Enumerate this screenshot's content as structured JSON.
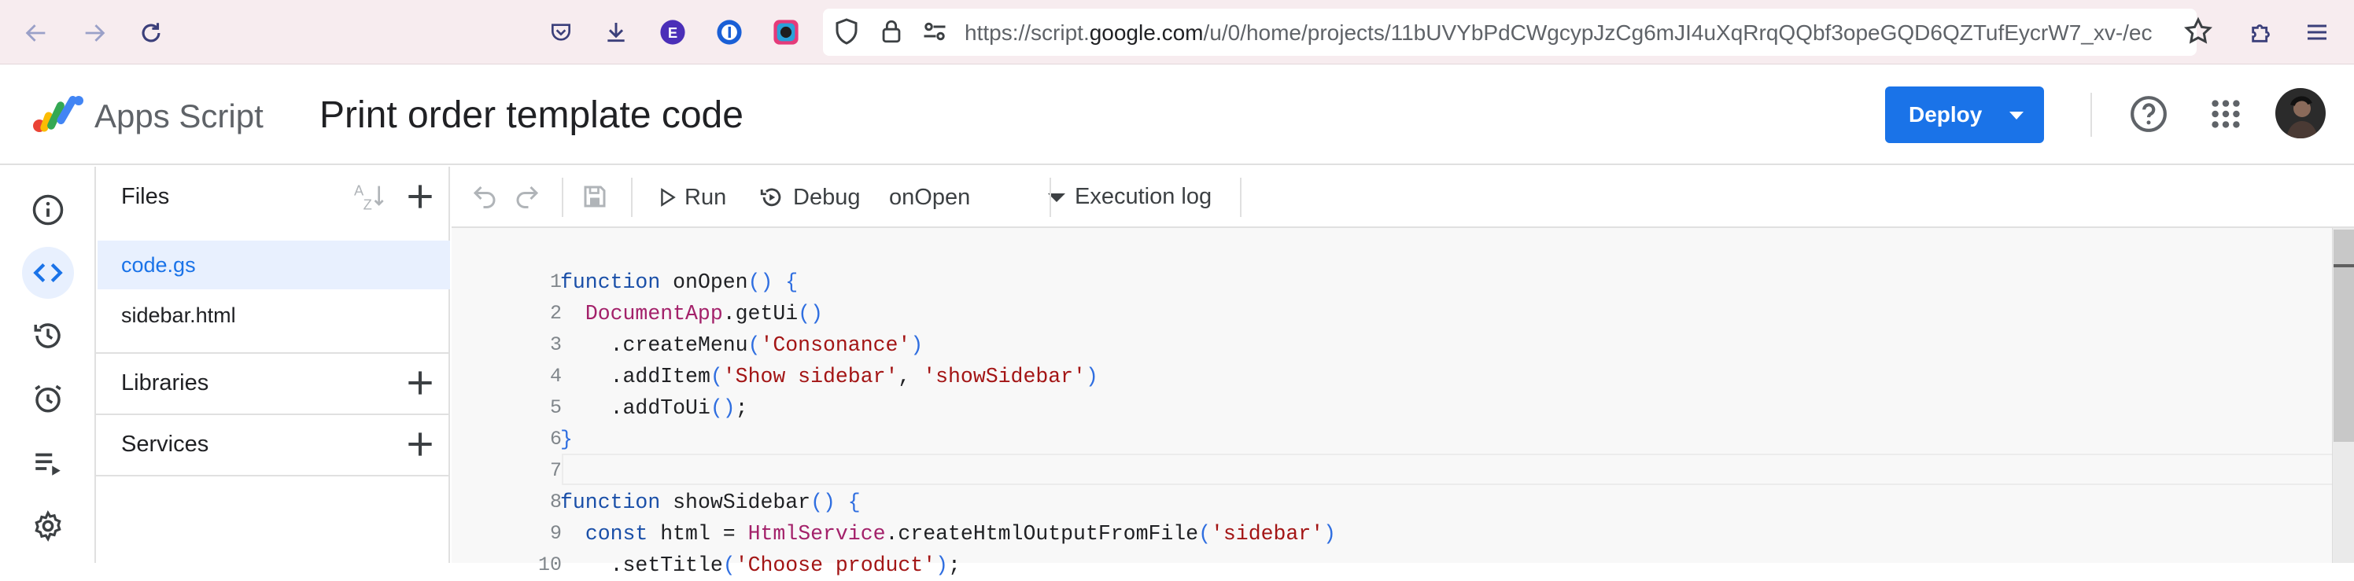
{
  "browser": {
    "url_prefix": "https://script.",
    "url_domain": "google.com",
    "url_rest": "/u/0/home/projects/11bUVYbPdCWgcypJzCg6mJI4uXqRrqQQbf3opeGQD6QZTufEycrW7_xv-/ec",
    "extensions": [
      "pocket-icon",
      "download-icon",
      "e-extension-icon",
      "onepassword-icon",
      "colorzilla-icon"
    ]
  },
  "app": {
    "product_name": "Apps Script",
    "project_title": "Print order template code",
    "deploy_label": "Deploy"
  },
  "files_panel": {
    "title": "Files",
    "files": [
      "code.gs",
      "sidebar.html"
    ],
    "selected_file": "code.gs",
    "libraries_label": "Libraries",
    "services_label": "Services"
  },
  "toolbar": {
    "run_label": "Run",
    "debug_label": "Debug",
    "function_name": "onOpen",
    "execution_log_label": "Execution log"
  },
  "editor": {
    "line_numbers": [
      "1",
      "2",
      "3",
      "4",
      "5",
      "6",
      "7",
      "8",
      "9",
      "10"
    ],
    "lines": [
      "function onOpen() {",
      "  DocumentApp.getUi()",
      "    .createMenu('Consonance')",
      "    .addItem('Show sidebar', 'showSidebar')",
      "    .addToUi();",
      "}",
      "",
      "function showSidebar() {",
      "  const html = HtmlService.createHtmlOutputFromFile('sidebar')",
      "    .setTitle('Choose product');"
    ]
  },
  "colors": {
    "accent": "#1a73e8",
    "keyword": "#1a4fa8",
    "class": "#a3216a",
    "string": "#a31515",
    "paren": "#0b6e2a",
    "chrome_bg": "#f7ecef"
  }
}
